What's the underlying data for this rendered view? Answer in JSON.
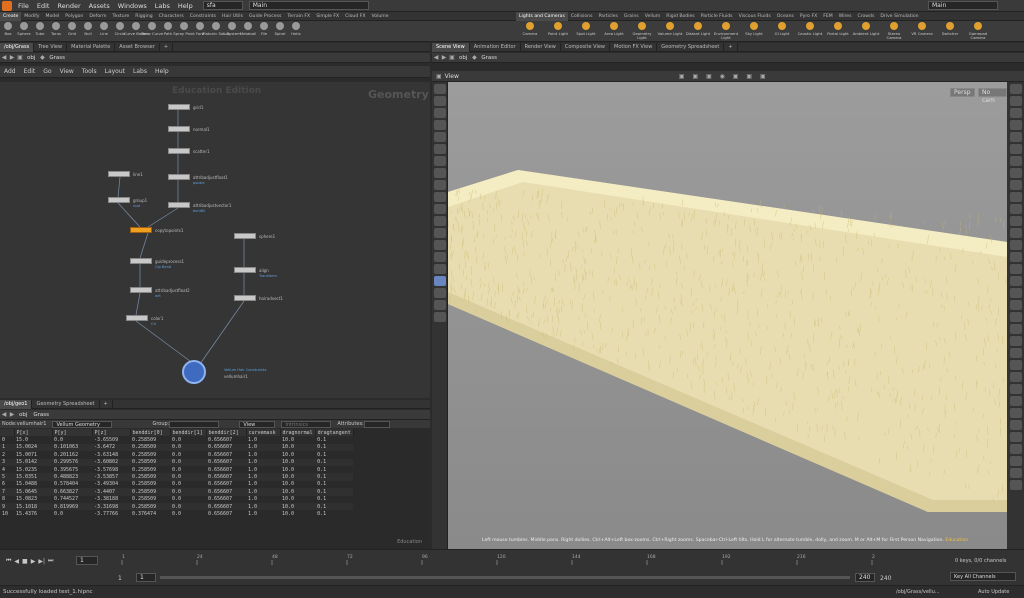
{
  "menu": {
    "items": [
      "File",
      "Edit",
      "Render",
      "Assets",
      "Windows",
      "Labs",
      "Help"
    ],
    "scene_file": "sfa",
    "desktop_left": "Main",
    "desktop_right": "Main"
  },
  "shelf": {
    "left_tabs": [
      "Create",
      "Modify",
      "Model",
      "Polygon",
      "Deform",
      "Texture",
      "Rigging",
      "Characters",
      "Constraints",
      "Hair Utils",
      "Guide Process",
      "Terrain FX",
      "Simple FX",
      "Cloud FX",
      "Volume"
    ],
    "right_tabs": [
      "Lights and Cameras",
      "Collisions",
      "Particles",
      "Grains",
      "Vellum",
      "Rigid Bodies",
      "Particle Fluids",
      "Viscous Fluids",
      "Oceans",
      "Pyro FX",
      "FEM",
      "Wires",
      "Crowds",
      "Drive Simulation"
    ],
    "left_tools": [
      "Box",
      "Sphere",
      "Tube",
      "Torus",
      "Grid",
      "Null",
      "Line",
      "Circle",
      "Curve Bezier",
      "Draw Curve",
      "Path",
      "Spray Paint",
      "Font",
      "Platonic Solids",
      "L-System",
      "Metaball",
      "File",
      "Spiral",
      "Helix"
    ],
    "right_tools": [
      "Camera",
      "Point Light",
      "Spot Light",
      "Area Light",
      "Geometry Light",
      "Volume Light",
      "Distant Light",
      "Environment Light",
      "Sky Light",
      "GI Light",
      "Caustic Light",
      "Portal Light",
      "Ambient Light",
      "Stereo Camera",
      "VR Camera",
      "Switcher",
      "Gamepad Camera"
    ]
  },
  "left_pane": {
    "tabs": [
      "/obj/Grass",
      "Tree View",
      "Material Palette",
      "Asset Browser"
    ],
    "path": [
      "obj",
      "Grass"
    ],
    "menu": [
      "Add",
      "Edit",
      "Go",
      "View",
      "Tools",
      "Layout",
      "Labs",
      "Help"
    ],
    "watermark": "Education Edition",
    "context": "Geometry"
  },
  "nodes": [
    {
      "name": "grid1"
    },
    {
      "name": "normal1"
    },
    {
      "name": "scatter1"
    },
    {
      "name": "attribadjustfloat1",
      "sub": "pscale"
    },
    {
      "name": "attribadjustvector1",
      "sub": "bendN"
    },
    {
      "name": "line1"
    },
    {
      "name": "group1",
      "sub": "root"
    },
    {
      "name": "copytopoints1"
    },
    {
      "name": "guideprocess1",
      "sub": "Clp Bend"
    },
    {
      "name": "attribadjustfloat2",
      "sub": "wrt"
    },
    {
      "name": "color1",
      "sub": "Cd"
    },
    {
      "name": "sphere1"
    },
    {
      "name": "align",
      "sub": "Transform"
    },
    {
      "name": "hairadvect1"
    },
    {
      "name": "vellumhair1",
      "sub": "Vellum Hair Constraints"
    }
  ],
  "sheet_pane": {
    "tabs": [
      "/obj/geo1",
      "Geometry Spreadsheet"
    ],
    "path": [
      "obj",
      "Grass"
    ],
    "node_label": "Node:",
    "node": "vellumhair1",
    "geo_mode": "Vellum Geometry",
    "group_label": "Group:",
    "view_label": "View",
    "intrinsics": "Intrinsics",
    "attributes_label": "Attributes:",
    "columns": [
      "",
      "P[x]",
      "P[y]",
      "P[z]",
      "benddir[0]",
      "benddir[1]",
      "benddir[2]",
      "curvemask",
      "dragnormal",
      "dragtangent"
    ],
    "rows": [
      [
        "0",
        "15.0",
        "0.0",
        "-3.65509",
        "0.258509",
        "0.0",
        "0.656607",
        "1.0",
        "10.0",
        "0.1"
      ],
      [
        "1",
        "15.0024",
        "0.101063",
        "-3.6472",
        "0.258509",
        "0.0",
        "0.656607",
        "1.0",
        "10.0",
        "0.1"
      ],
      [
        "2",
        "15.0071",
        "0.201162",
        "-3.63148",
        "0.258509",
        "0.0",
        "0.656607",
        "1.0",
        "10.0",
        "0.1"
      ],
      [
        "3",
        "15.0142",
        "0.299576",
        "-3.60802",
        "0.258509",
        "0.0",
        "0.656607",
        "1.0",
        "10.0",
        "0.1"
      ],
      [
        "4",
        "15.0235",
        "0.395675",
        "-3.57698",
        "0.258509",
        "0.0",
        "0.656607",
        "1.0",
        "10.0",
        "0.1"
      ],
      [
        "5",
        "15.0351",
        "0.488823",
        "-3.53857",
        "0.258509",
        "0.0",
        "0.656607",
        "1.0",
        "10.0",
        "0.1"
      ],
      [
        "6",
        "15.0488",
        "0.578404",
        "-3.49304",
        "0.258509",
        "0.0",
        "0.656607",
        "1.0",
        "10.0",
        "0.1"
      ],
      [
        "7",
        "15.0645",
        "0.663827",
        "-3.4407",
        "0.258509",
        "0.0",
        "0.656607",
        "1.0",
        "10.0",
        "0.1"
      ],
      [
        "8",
        "15.0823",
        "0.744527",
        "-3.38188",
        "0.258509",
        "0.0",
        "0.656607",
        "1.0",
        "10.0",
        "0.1"
      ],
      [
        "9",
        "15.1018",
        "0.819969",
        "-3.31698",
        "0.258509",
        "0.0",
        "0.656607",
        "1.0",
        "10.0",
        "0.1"
      ],
      [
        "10",
        "15.4376",
        "0.0",
        "-3.77766",
        "0.376474",
        "0.0",
        "0.656607",
        "1.0",
        "10.0",
        "0.1"
      ]
    ],
    "watermark": "Education"
  },
  "right_pane": {
    "tabs": [
      "Scene View",
      "Animation Editor",
      "Render View",
      "Composite View",
      "Motion FX View",
      "Geometry Spreadsheet"
    ],
    "path": [
      "obj",
      "Grass"
    ],
    "view_label": "View",
    "persp": "Persp",
    "cam": "No cam",
    "hint": "Left mouse tumbles. Middle pans. Right dollies. Ctrl+Alt+Left box-zooms. Ctrl+Right zooms. Spacebar-Ctrl-Left tilts. Hold L for alternate tumble, dolly, and zoom.    M or Alt+M for First Person Navigation.",
    "watermark": "Education"
  },
  "timeline": {
    "frame": "1",
    "start": "1",
    "start2": "1",
    "end": "240",
    "end2": "240",
    "ticks": [
      "1",
      "24",
      "48",
      "72",
      "96",
      "120",
      "144",
      "168",
      "192",
      "216",
      "2"
    ],
    "keys": "0 keys, 0/0 channels",
    "key_all": "Key All Channels"
  },
  "status": {
    "message": "Successfully loaded test_1.hipnc",
    "path": "/obj/Grass/vellu...",
    "auto_update": "Auto Update"
  },
  "colors": {
    "accent": "#f0a020",
    "grass": "#efe4a6",
    "link": "#5ea0e0"
  }
}
